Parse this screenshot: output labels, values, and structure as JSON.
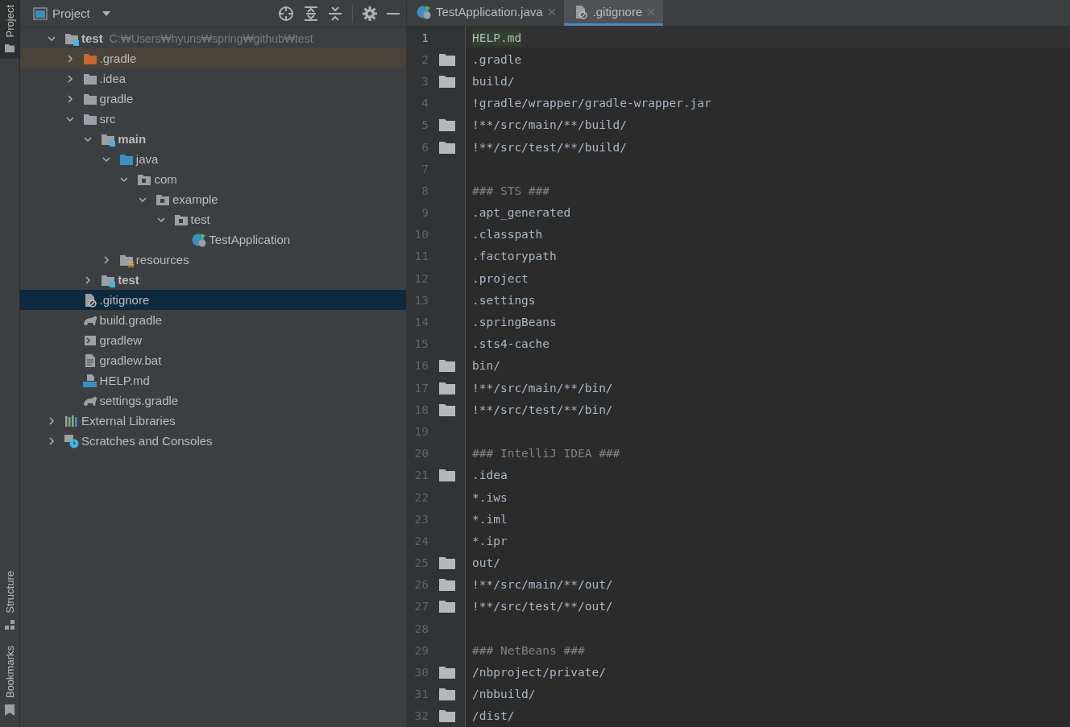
{
  "tool_strip": {
    "top": [
      {
        "label": "Project",
        "kind": "folder",
        "selected": true
      }
    ],
    "bottom": [
      {
        "label": "Structure",
        "kind": "structure",
        "selected": false
      },
      {
        "label": "Bookmarks",
        "kind": "bookmark",
        "selected": false
      }
    ]
  },
  "project_panel": {
    "title": "Project",
    "tree": [
      {
        "label": "test",
        "path": "C:₩Users₩hyuns₩spring₩github₩test",
        "bold": true,
        "kind": "module",
        "expanded": true,
        "selected": false,
        "children": [
          {
            "label": ".gradle",
            "kind": "excluded",
            "expanded": false,
            "selected": false
          },
          {
            "label": ".idea",
            "kind": "folder",
            "expanded": false,
            "selected": false
          },
          {
            "label": "gradle",
            "kind": "folder",
            "expanded": false,
            "selected": false
          },
          {
            "label": "src",
            "kind": "folder",
            "expanded": true,
            "selected": false,
            "children": [
              {
                "label": "main",
                "bold": true,
                "kind": "module",
                "expanded": true,
                "selected": false,
                "children": [
                  {
                    "label": "java",
                    "kind": "source",
                    "expanded": true,
                    "selected": false,
                    "children": [
                      {
                        "label": "com",
                        "kind": "package",
                        "expanded": true,
                        "selected": false,
                        "children": [
                          {
                            "label": "example",
                            "kind": "package",
                            "expanded": true,
                            "selected": false,
                            "children": [
                              {
                                "label": "test",
                                "kind": "package",
                                "expanded": true,
                                "selected": false,
                                "children": [
                                  {
                                    "label": "TestApplication",
                                    "kind": "spring",
                                    "selected": false
                                  }
                                ]
                              }
                            ]
                          }
                        ]
                      }
                    ]
                  },
                  {
                    "label": "resources",
                    "kind": "resources",
                    "expanded": false,
                    "selected": false
                  }
                ]
              },
              {
                "label": "test",
                "bold": true,
                "kind": "module",
                "expanded": false,
                "selected": false
              }
            ]
          },
          {
            "label": ".gitignore",
            "kind": "ignore",
            "selected": true
          },
          {
            "label": "build.gradle",
            "kind": "gradle",
            "selected": false
          },
          {
            "label": "gradlew",
            "kind": "shell",
            "selected": false
          },
          {
            "label": "gradlew.bat",
            "kind": "text",
            "selected": false
          },
          {
            "label": "HELP.md",
            "kind": "md",
            "selected": false
          },
          {
            "label": "settings.gradle",
            "kind": "gradle",
            "selected": false
          }
        ]
      },
      {
        "label": "External Libraries",
        "kind": "libraries",
        "expanded": false,
        "selected": false
      },
      {
        "label": "Scratches and Consoles",
        "kind": "scratches",
        "expanded": false,
        "selected": false
      }
    ]
  },
  "editor": {
    "tabs": [
      {
        "label": "TestApplication.java",
        "kind": "spring",
        "selected": false
      },
      {
        "label": ".gitignore",
        "kind": "ignore",
        "selected": true
      }
    ],
    "lines": [
      {
        "number": "1",
        "text": "HELP.md",
        "kind": "path",
        "folder": false,
        "current": true
      },
      {
        "number": "2",
        "text": ".gradle",
        "kind": "path",
        "folder": true,
        "current": false
      },
      {
        "number": "3",
        "text": "build/",
        "kind": "path",
        "folder": true,
        "current": false
      },
      {
        "number": "4",
        "text": "!gradle/wrapper/gradle-wrapper.jar",
        "kind": "path",
        "folder": false,
        "current": false
      },
      {
        "number": "5",
        "text": "!**/src/main/**/build/",
        "kind": "path",
        "folder": true,
        "current": false
      },
      {
        "number": "6",
        "text": "!**/src/test/**/build/",
        "kind": "path",
        "folder": true,
        "current": false
      },
      {
        "number": "7",
        "folder": false,
        "current": false
      },
      {
        "number": "8",
        "text": "### STS ###",
        "kind": "comment",
        "folder": false,
        "current": false
      },
      {
        "number": "9",
        "text": ".apt_generated",
        "kind": "path",
        "folder": false,
        "current": false
      },
      {
        "number": "10",
        "text": ".classpath",
        "kind": "path",
        "folder": false,
        "current": false
      },
      {
        "number": "11",
        "text": ".factorypath",
        "kind": "path",
        "folder": false,
        "current": false
      },
      {
        "number": "12",
        "text": ".project",
        "kind": "path",
        "folder": false,
        "current": false
      },
      {
        "number": "13",
        "text": ".settings",
        "kind": "path",
        "folder": false,
        "current": false
      },
      {
        "number": "14",
        "text": ".springBeans",
        "kind": "path",
        "folder": false,
        "current": false
      },
      {
        "number": "15",
        "text": ".sts4-cache",
        "kind": "path",
        "folder": false,
        "current": false
      },
      {
        "number": "16",
        "text": "bin/",
        "kind": "path",
        "folder": true,
        "current": false
      },
      {
        "number": "17",
        "text": "!**/src/main/**/bin/",
        "kind": "path",
        "folder": true,
        "current": false
      },
      {
        "number": "18",
        "text": "!**/src/test/**/bin/",
        "kind": "path",
        "folder": true,
        "current": false
      },
      {
        "number": "19",
        "folder": false,
        "current": false
      },
      {
        "number": "20",
        "text": "### IntelliJ IDEA ###",
        "kind": "comment",
        "folder": false,
        "current": false
      },
      {
        "number": "21",
        "text": ".idea",
        "kind": "path",
        "folder": true,
        "current": false
      },
      {
        "number": "22",
        "text": "*.iws",
        "kind": "path",
        "folder": false,
        "current": false
      },
      {
        "number": "23",
        "text": "*.iml",
        "kind": "path",
        "folder": false,
        "current": false
      },
      {
        "number": "24",
        "text": "*.ipr",
        "kind": "path",
        "folder": false,
        "current": false
      },
      {
        "number": "25",
        "text": "out/",
        "kind": "path",
        "folder": true,
        "current": false
      },
      {
        "number": "26",
        "text": "!**/src/main/**/out/",
        "kind": "path",
        "folder": true,
        "current": false
      },
      {
        "number": "27",
        "text": "!**/src/test/**/out/",
        "kind": "path",
        "folder": true,
        "current": false
      },
      {
        "number": "28",
        "folder": false,
        "current": false
      },
      {
        "number": "29",
        "text": "### NetBeans ###",
        "kind": "comment",
        "folder": false,
        "current": false
      },
      {
        "number": "30",
        "text": "/nbproject/private/",
        "kind": "path",
        "folder": true,
        "current": false
      },
      {
        "number": "31",
        "text": "/nbbuild/",
        "kind": "path",
        "folder": true,
        "current": false
      },
      {
        "number": "32",
        "text": "/dist/",
        "kind": "path",
        "folder": true,
        "current": false
      }
    ]
  }
}
